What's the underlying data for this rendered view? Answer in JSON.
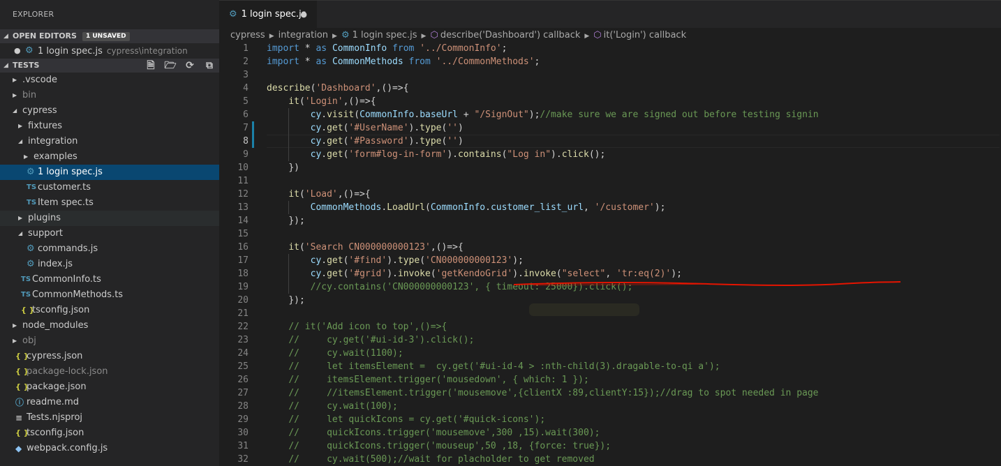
{
  "sidebar": {
    "title": "EXPLORER",
    "open_editors": {
      "label": "OPEN EDITORS",
      "badge": "1 UNSAVED",
      "file": "1 login spec.js",
      "desc": "cypress\\integration"
    },
    "tests": {
      "label": "TESTS"
    },
    "tree": [
      {
        "label": ".vscode",
        "depth": 0,
        "type": "folder"
      },
      {
        "label": "bin",
        "depth": 0,
        "type": "folder",
        "dim": true
      },
      {
        "label": "cypress",
        "depth": 0,
        "type": "folder-open"
      },
      {
        "label": "fixtures",
        "depth": 1,
        "type": "folder"
      },
      {
        "label": "integration",
        "depth": 1,
        "type": "folder-open"
      },
      {
        "label": "examples",
        "depth": 2,
        "type": "folder"
      },
      {
        "label": "1 login spec.js",
        "depth": 2,
        "type": "gear",
        "selected": true
      },
      {
        "label": "customer.ts",
        "depth": 2,
        "type": "ts"
      },
      {
        "label": "Item spec.ts",
        "depth": 2,
        "type": "ts"
      },
      {
        "label": "plugins",
        "depth": 1,
        "type": "folder"
      },
      {
        "label": "support",
        "depth": 1,
        "type": "folder-open"
      },
      {
        "label": "commands.js",
        "depth": 2,
        "type": "gear"
      },
      {
        "label": "index.js",
        "depth": 2,
        "type": "gear"
      },
      {
        "label": "CommonInfo.ts",
        "depth": 1,
        "type": "ts"
      },
      {
        "label": "CommonMethods.ts",
        "depth": 1,
        "type": "ts"
      },
      {
        "label": "tsconfig.json",
        "depth": 1,
        "type": "json"
      },
      {
        "label": "node_modules",
        "depth": 0,
        "type": "folder"
      },
      {
        "label": "obj",
        "depth": 0,
        "type": "folder",
        "dim": true
      },
      {
        "label": "cypress.json",
        "depth": 0,
        "type": "json"
      },
      {
        "label": "package-lock.json",
        "depth": 0,
        "type": "json",
        "dim": true
      },
      {
        "label": "package.json",
        "depth": 0,
        "type": "json"
      },
      {
        "label": "readme.md",
        "depth": 0,
        "type": "info"
      },
      {
        "label": "Tests.njsproj",
        "depth": 0,
        "type": "lines"
      },
      {
        "label": "tsconfig.json",
        "depth": 0,
        "type": "json"
      },
      {
        "label": "webpack.config.js",
        "depth": 0,
        "type": "cube"
      }
    ]
  },
  "tab": {
    "label": "1 login spec.js"
  },
  "breadcrumb": [
    "cypress",
    "integration",
    "1 login spec.js",
    "describe('Dashboard') callback",
    "it('Login') callback"
  ],
  "code_lines": [
    "import * as CommonInfo from '../CommonInfo';",
    "import * as CommonMethods from '../CommonMethods';",
    "",
    "describe('Dashboard',()=>{",
    "    it('Login',()=>{",
    "        cy.visit(CommonInfo.baseUrl + \"/SignOut\");//make sure we are signed out before testing signin",
    "        cy.get('#UserName').type('')",
    "        cy.get('#Password').type('')",
    "        cy.get('form#log-in-form').contains(\"Log in\").click();",
    "    })",
    "",
    "    it('Load',()=>{",
    "        CommonMethods.LoadUrl(CommonInfo.customer_list_url, '/customer');",
    "    });",
    "",
    "    it('Search CN000000000123',()=>{",
    "        cy.get('#find').type('CN000000000123');",
    "        cy.get('#grid').invoke('getKendoGrid').invoke(\"select\", 'tr:eq(2)');",
    "        //cy.contains('CN000000000123', { timeout: 25000}).click();",
    "    });",
    "",
    "    // it('Add icon to top',()=>{",
    "    //     cy.get('#ui-id-3').click();",
    "    //     cy.wait(1100);",
    "    //     let itemsElement =  cy.get('#ui-id-4 > :nth-child(3).dragable-to-qi a');",
    "    //     itemsElement.trigger('mousedown', { which: 1 });",
    "    //     //itemsElement.trigger('mousemove',{clientX :89,clientY:15});//drag to spot needed in page",
    "    //     cy.wait(100);",
    "    //     let quickIcons = cy.get('#quick-icons');",
    "    //     quickIcons.trigger('mousemove',300 ,15).wait(300);",
    "    //     quickIcons.trigger('mouseup',50 ,18, {force: true});",
    "    //     cy.wait(500);//wait for placholder to get removed"
  ],
  "active_line": 8,
  "colors": {
    "selection": "#094771",
    "keyword": "#569cd6",
    "string": "#ce9178",
    "comment": "#6a9955",
    "function": "#dcdcaa",
    "variable": "#9cdcfe",
    "annotation": "#e51400"
  }
}
